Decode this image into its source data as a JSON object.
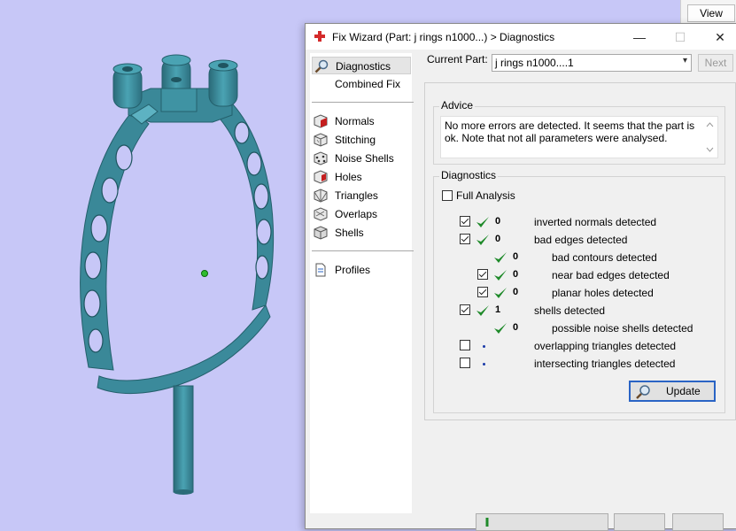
{
  "view_button": {
    "label": "View"
  },
  "window": {
    "title": "Fix Wizard (Part: j rings n1000...) > Diagnostics",
    "minimize_symbol": "—",
    "maximize_symbol": "☐",
    "close_symbol": "✕",
    "title_icon": "red-cross-icon"
  },
  "sidebar": {
    "items": [
      {
        "label": "Diagnostics",
        "icon": "magnifier-icon"
      },
      {
        "label": "Combined Fix",
        "icon": ""
      },
      {
        "label": "Normals",
        "icon": "normals-cube-icon"
      },
      {
        "label": "Stitching",
        "icon": "stitching-cube-icon"
      },
      {
        "label": "Noise Shells",
        "icon": "noise-shells-cube-icon"
      },
      {
        "label": "Holes",
        "icon": "holes-cube-icon"
      },
      {
        "label": "Triangles",
        "icon": "triangles-cube-icon"
      },
      {
        "label": "Overlaps",
        "icon": "overlaps-cube-icon"
      },
      {
        "label": "Shells",
        "icon": "shells-cube-icon"
      },
      {
        "label": "Profiles",
        "icon": "document-icon"
      }
    ]
  },
  "current_part": {
    "label": "Current Part:",
    "value": "j rings n1000....1",
    "next_label": "Next"
  },
  "advice": {
    "title": "Advice",
    "text": "No more errors are detected. It seems that the part is ok. Note that not all parameters were analysed."
  },
  "diagnostics": {
    "title": "Diagnostics",
    "full_analysis_label": "Full Analysis",
    "full_analysis_checked": false,
    "rows": [
      {
        "checkbox": true,
        "checked": true,
        "status": "ok",
        "count": "0",
        "label": "inverted normals detected",
        "indent": 0
      },
      {
        "checkbox": true,
        "checked": true,
        "status": "ok",
        "count": "0",
        "label": "bad edges detected",
        "indent": 0
      },
      {
        "checkbox": false,
        "checked": false,
        "status": "ok",
        "count": "0",
        "label": "bad contours detected",
        "indent": 1
      },
      {
        "checkbox": true,
        "checked": true,
        "status": "ok",
        "count": "0",
        "label": "near bad edges detected",
        "indent": 1
      },
      {
        "checkbox": true,
        "checked": true,
        "status": "ok",
        "count": "0",
        "label": "planar holes detected",
        "indent": 1
      },
      {
        "checkbox": true,
        "checked": true,
        "status": "ok",
        "count": "1",
        "label": "shells detected",
        "indent": 0
      },
      {
        "checkbox": false,
        "checked": false,
        "status": "ok",
        "count": "0",
        "label": "possible noise shells detected",
        "indent": 1
      },
      {
        "checkbox": true,
        "checked": false,
        "status": "none",
        "count": "",
        "label": "overlapping triangles detected",
        "indent": 0
      },
      {
        "checkbox": true,
        "checked": false,
        "status": "none",
        "count": "",
        "label": "intersecting triangles detected",
        "indent": 0
      }
    ],
    "update_label": "Update"
  },
  "colors": {
    "viewport_bg": "#c7c7f7",
    "model": "#3a8a9a",
    "tick_green": "#1f8a2a",
    "focus_blue": "#2a64c5"
  }
}
